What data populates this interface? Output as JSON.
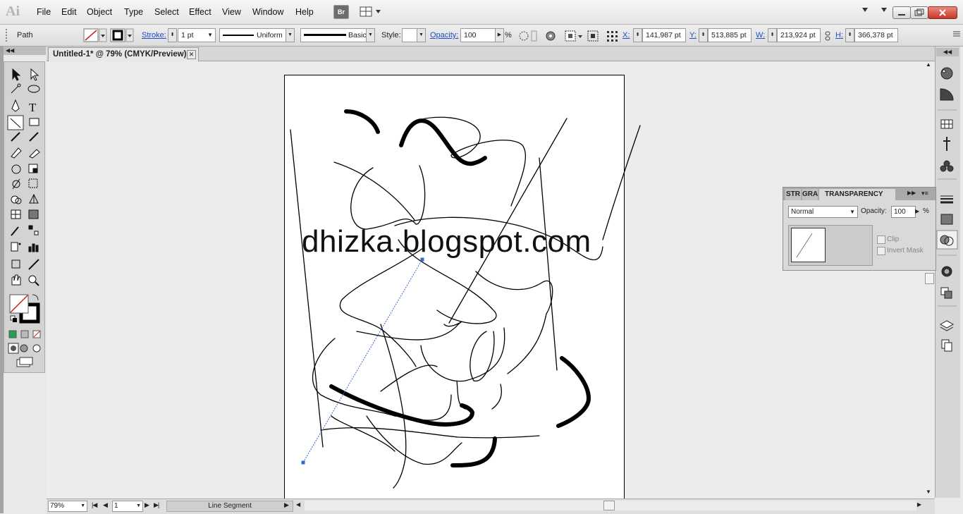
{
  "app": {
    "logo": "Ai",
    "bridge": "Br"
  },
  "menu": [
    "File",
    "Edit",
    "Object",
    "Type",
    "Select",
    "Effect",
    "View",
    "Window",
    "Help"
  ],
  "control": {
    "object_type": "Path",
    "stroke_label": "Stroke:",
    "stroke_weight": "1 pt",
    "profile": "Uniform",
    "brush": "Basic",
    "style_label": "Style:",
    "opacity_label": "Opacity:",
    "opacity_value": "100",
    "percent": "%",
    "x_label": "X:",
    "x_value": "141,987 pt",
    "y_label": "Y:",
    "y_value": "513,885 pt",
    "w_label": "W:",
    "w_value": "213,924 pt",
    "h_label": "H:",
    "h_value": "366,378 pt"
  },
  "document": {
    "tab_title": "Untitled-1* @ 79% (CMYK/Preview)",
    "watermark": "dhizka.blogspot.com"
  },
  "transparency": {
    "tabs": [
      "STR",
      "GRA",
      "TRANSPARENCY"
    ],
    "blend_mode": "Normal",
    "opacity_label": "Opacity:",
    "opacity_value": "100",
    "percent": "%",
    "clip_label": "Clip",
    "invert_label": "Invert Mask"
  },
  "status": {
    "zoom": "79%",
    "page": "1",
    "current_tool": "Line Segment"
  },
  "colors": {
    "accent_link": "#1f4ec9",
    "selection": "#3a66c9",
    "no_fill_red": "#d21a1a"
  }
}
